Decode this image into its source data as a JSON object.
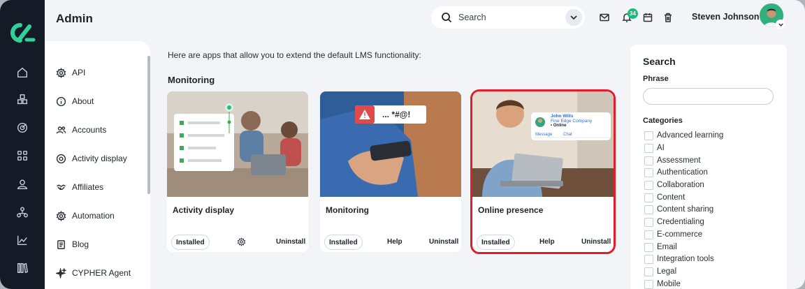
{
  "header": {
    "title": "Admin",
    "search_placeholder": "Search",
    "notifications_count": "34",
    "user_name": "Steven Johnson"
  },
  "rail": {
    "icons": [
      "home-icon",
      "boxes-icon",
      "target-icon",
      "grid-icon",
      "user-icon",
      "org-icon",
      "chart-icon",
      "library-icon"
    ]
  },
  "subnav": {
    "items": [
      {
        "label": "API",
        "icon": "gear-icon"
      },
      {
        "label": "About",
        "icon": "info-icon"
      },
      {
        "label": "Accounts",
        "icon": "users-icon"
      },
      {
        "label": "Activity display",
        "icon": "target-icon"
      },
      {
        "label": "Affiliates",
        "icon": "handshake-icon"
      },
      {
        "label": "Automation",
        "icon": "gear-icon"
      },
      {
        "label": "Blog",
        "icon": "document-icon"
      },
      {
        "label": "CYPHER Agent",
        "icon": "sparkle-icon"
      }
    ]
  },
  "main": {
    "intro": "Here are apps that allow you to extend the default LMS functionality:",
    "section_title": "Monitoring",
    "cards": [
      {
        "title": "Activity display",
        "status": "Installed",
        "link1": "",
        "link2": "Uninstall",
        "selected": false
      },
      {
        "title": "Monitoring",
        "status": "Installed",
        "link1": "Help",
        "link2": "Uninstall",
        "selected": false
      },
      {
        "title": "Online presence",
        "status": "Installed",
        "link1": "Help",
        "link2": "Uninstall",
        "selected": true
      }
    ],
    "monitoring_bubble": "... *#@!",
    "presence_popup": {
      "name": "John Wills",
      "company": "Fine Edge Company",
      "status": "• Online",
      "message": "Message",
      "chat": "Chat"
    }
  },
  "right_panel": {
    "title": "Search",
    "phrase_label": "Phrase",
    "phrase_value": "",
    "categories_label": "Categories",
    "categories": [
      "Advanced learning",
      "AI",
      "Assessment",
      "Authentication",
      "Collaboration",
      "Content",
      "Content sharing",
      "Credentialing",
      "E-commerce",
      "Email",
      "Integration tools",
      "Legal",
      "Mobile"
    ]
  },
  "colors": {
    "rail": "#141b26",
    "accent": "#1db87a",
    "selected_outline": "#e11d2a",
    "background": "#f2f4f7"
  }
}
